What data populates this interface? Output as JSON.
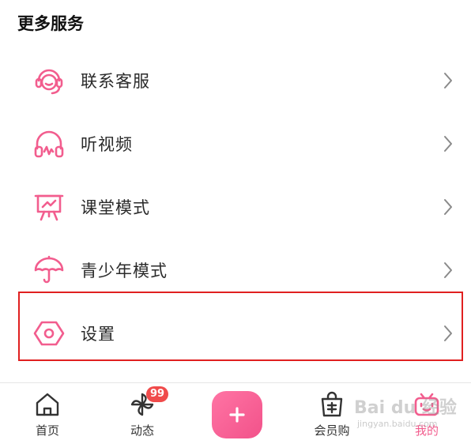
{
  "section": {
    "title": "更多服务"
  },
  "colors": {
    "accent": "#f25d8e",
    "highlight": "#e02020",
    "badge": "#f04b4b"
  },
  "menu": [
    {
      "label": "联系客服",
      "icon": "headset-icon"
    },
    {
      "label": "听视频",
      "icon": "headphones-icon"
    },
    {
      "label": "课堂模式",
      "icon": "presentation-board-icon"
    },
    {
      "label": "青少年模式",
      "icon": "umbrella-icon"
    },
    {
      "label": "设置",
      "icon": "settings-hexagon-icon"
    }
  ],
  "tabbar": {
    "home": {
      "label": "首页",
      "icon": "home-icon"
    },
    "feed": {
      "label": "动态",
      "icon": "pinwheel-icon",
      "badge": "99"
    },
    "publish": {
      "icon": "plus-icon"
    },
    "vip": {
      "label": "会员购",
      "icon": "shopping-bag-icon"
    },
    "mine": {
      "label": "我的",
      "icon": "tv-mascot-icon"
    }
  },
  "watermark": {
    "text": "Bai du 经验",
    "sub": "jingyan.baidu.com"
  }
}
